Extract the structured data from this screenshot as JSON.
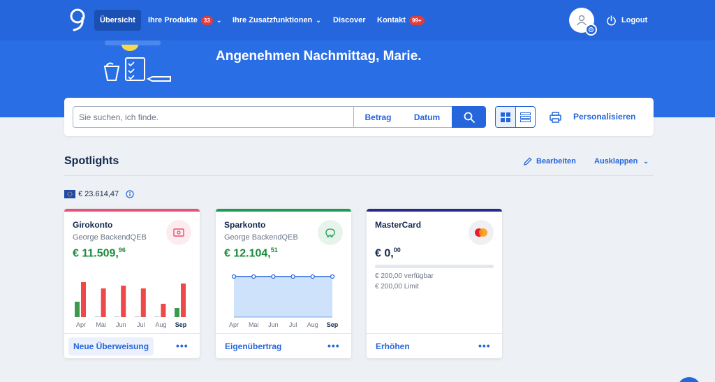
{
  "nav": {
    "items": [
      {
        "label": "Übersicht"
      },
      {
        "label": "Ihre Produkte",
        "badge": "33"
      },
      {
        "label": "Ihre Zusatzfunktionen"
      },
      {
        "label": "Discover"
      },
      {
        "label": "Kontakt",
        "badge": "99+"
      }
    ],
    "logout": "Logout"
  },
  "greeting": "Angenehmen Nachmittag, Marie.",
  "search": {
    "placeholder": "Sie suchen, ich finde.",
    "filter_amount": "Betrag",
    "filter_date": "Datum",
    "personalize": "Personalisieren"
  },
  "spotlights": {
    "title": "Spotlights",
    "edit": "Bearbeiten",
    "expand": "Ausklappen",
    "total": "€ 23.614,47"
  },
  "cards": [
    {
      "name": "Girokonto",
      "owner": "George BackendQEB",
      "amount_main": "€ 11.509,",
      "amount_cents": "96",
      "action": "Neue Überweisung",
      "accent": "#e85178",
      "amount_color": "#1b8a3a"
    },
    {
      "name": "Sparkonto",
      "owner": "George BackendQEB",
      "amount_main": "€ 12.104,",
      "amount_cents": "51",
      "action": "Eigenübertrag",
      "accent": "#1f9a55",
      "amount_color": "#1b8a3a"
    },
    {
      "name": "MasterCard",
      "amount_main": "€ 0,",
      "amount_cents": "00",
      "available": "€ 200,00 verfügbar",
      "limit": "€ 200,00 Limit",
      "limit_used_fraction": 0,
      "action": "Erhöhen",
      "accent": "#262a8c",
      "amount_color": "#13284d"
    }
  ],
  "chart_data": [
    {
      "type": "bar",
      "categories": [
        "Apr",
        "Mai",
        "Jun",
        "Jul",
        "Aug",
        "Sep"
      ],
      "series": [
        {
          "values": [
            22,
            0,
            0,
            0,
            0,
            13
          ],
          "color": "#3b9a4c"
        },
        {
          "values": [
            50,
            41,
            45,
            41,
            19,
            48
          ],
          "color": "#ee4848"
        }
      ],
      "highlight_category": "Sep"
    },
    {
      "type": "area",
      "categories": [
        "Apr",
        "Mai",
        "Jun",
        "Jul",
        "Aug",
        "Sep"
      ],
      "values": [
        12104.51,
        12104.51,
        12104.51,
        12104.51,
        12104.51,
        12104.51
      ],
      "highlight_category": "Sep",
      "color": "#2566dc"
    }
  ]
}
